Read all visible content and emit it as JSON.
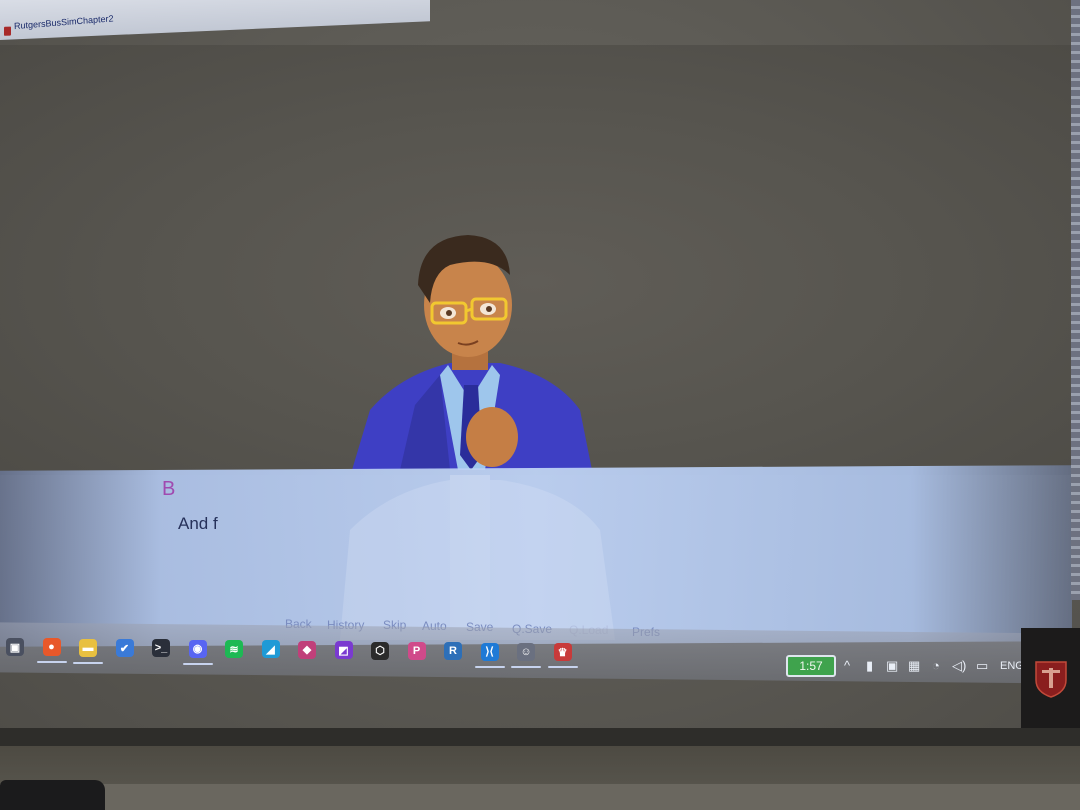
{
  "window": {
    "title": "RutgersBusSimChapter2"
  },
  "dialogue": {
    "speaker": "B",
    "text": "And f"
  },
  "quick_menu": [
    {
      "label": "Back",
      "enabled": true
    },
    {
      "label": "History",
      "enabled": true
    },
    {
      "label": "Skip",
      "enabled": true
    },
    {
      "label": "Auto",
      "enabled": true
    },
    {
      "label": "Save",
      "enabled": true
    },
    {
      "label": "Q.Save",
      "enabled": true
    },
    {
      "label": "Q.Load",
      "enabled": false
    },
    {
      "label": "Prefs",
      "enabled": true
    }
  ],
  "taskbar": {
    "apps": [
      {
        "icon": "taskview-icon",
        "glyph": "▣",
        "color": "#4a5060",
        "running": false
      },
      {
        "icon": "firefox-icon",
        "glyph": "●",
        "color": "#e8582a",
        "running": true
      },
      {
        "icon": "file-explorer-icon",
        "glyph": "▬",
        "color": "#e8c040",
        "running": true
      },
      {
        "icon": "todo-icon",
        "glyph": "✔",
        "color": "#3a7ad8",
        "running": false
      },
      {
        "icon": "terminal-icon",
        "glyph": ">_",
        "color": "#2a2f3a",
        "running": false
      },
      {
        "icon": "discord-icon",
        "glyph": "◉",
        "color": "#5865f2",
        "running": true
      },
      {
        "icon": "spotify-icon",
        "glyph": "≋",
        "color": "#1db954",
        "running": false
      },
      {
        "icon": "affinity-designer-icon",
        "glyph": "◢",
        "color": "#1f9ad6",
        "running": false
      },
      {
        "icon": "affinity-publisher-icon",
        "glyph": "◆",
        "color": "#c0407a",
        "running": false
      },
      {
        "icon": "affinity-photo-icon",
        "glyph": "◩",
        "color": "#7a3ad0",
        "running": false
      },
      {
        "icon": "unity-hub-icon",
        "glyph": "⬡",
        "color": "#2b2b2b",
        "running": false
      },
      {
        "icon": "pycharm-icon",
        "glyph": "P",
        "color": "#d04a8a",
        "running": false
      },
      {
        "icon": "r-studio-icon",
        "glyph": "R",
        "color": "#2d6fb8",
        "running": false
      },
      {
        "icon": "vscode-icon",
        "glyph": "⟩⟨",
        "color": "#1f7ad6",
        "running": true
      },
      {
        "icon": "renpy-icon",
        "glyph": "☺",
        "color": "#6a7080",
        "running": true
      },
      {
        "icon": "renpy-game-icon",
        "glyph": "♛",
        "color": "#c83a3a",
        "running": true
      }
    ]
  },
  "tray": {
    "battery": "1:57",
    "language": "ENG"
  },
  "colors": {
    "speaker": "#a04ab0",
    "dialogue_text": "#26315a",
    "quick_menu": "#7a8cc0",
    "battery_bg": "#3fa34d"
  }
}
